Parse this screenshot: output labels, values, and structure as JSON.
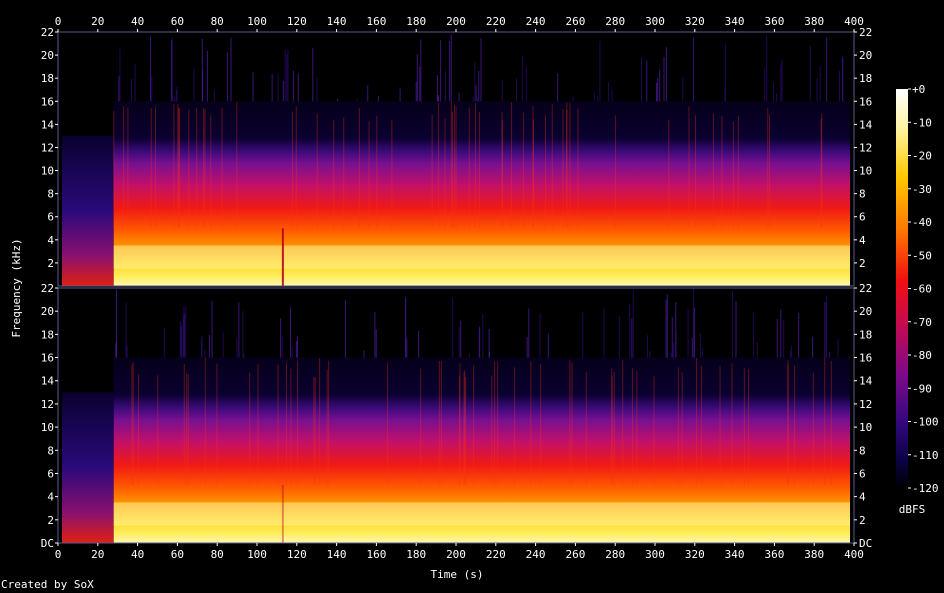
{
  "chart_data": {
    "type": "heatmap",
    "title": "",
    "xlabel": "Time (s)",
    "ylabel": "Frequency (kHz)",
    "colorbar_label": "dBFS",
    "xlim": [
      0,
      400
    ],
    "ylim": [
      0,
      22
    ],
    "x_ticks": [
      0,
      20,
      40,
      60,
      80,
      100,
      120,
      140,
      160,
      180,
      200,
      220,
      240,
      260,
      280,
      300,
      320,
      340,
      360,
      380,
      400
    ],
    "y_ticks_top": [
      "2",
      "4",
      "6",
      "8",
      "10",
      "12",
      "14",
      "16",
      "18",
      "20",
      "22"
    ],
    "y_ticks_bottom": [
      "DC",
      "2",
      "4",
      "6",
      "8",
      "10",
      "12",
      "14",
      "16",
      "18",
      "20",
      "22"
    ],
    "colorbar_ticks": [
      "+0",
      "-10",
      "-20",
      "-30",
      "-40",
      "-50",
      "-60",
      "-70",
      "-80",
      "-90",
      "-100",
      "-110",
      "-120"
    ],
    "colorbar_range": [
      -120,
      0
    ],
    "channels": 2,
    "band_limit_khz": 16,
    "onset_time_s": 28,
    "dropout_time_s": 113
  },
  "footer": {
    "credit": "Created by SoX"
  }
}
